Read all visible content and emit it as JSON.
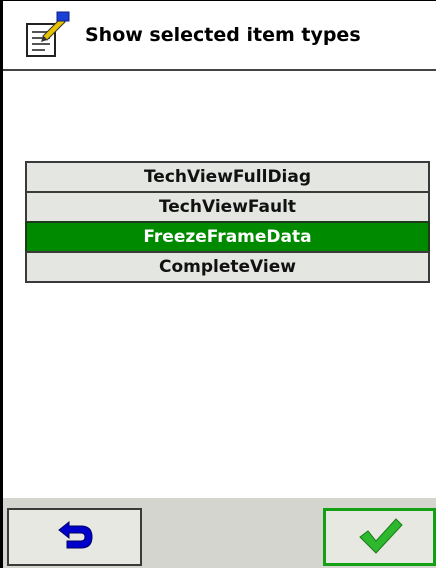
{
  "header": {
    "title": "Show selected item types",
    "icon": "document-edit-icon"
  },
  "list": {
    "items": [
      {
        "label": "TechViewFullDiag",
        "selected": false
      },
      {
        "label": "TechViewFault",
        "selected": false
      },
      {
        "label": "FreezeFrameData",
        "selected": true
      },
      {
        "label": "CompleteView",
        "selected": false
      }
    ],
    "selected_color": "#008a00"
  },
  "footer": {
    "back_icon": "return-arrow-icon",
    "ok_icon": "checkmark-icon",
    "back_icon_color": "#0000cc",
    "ok_icon_color": "#2eb82e"
  }
}
